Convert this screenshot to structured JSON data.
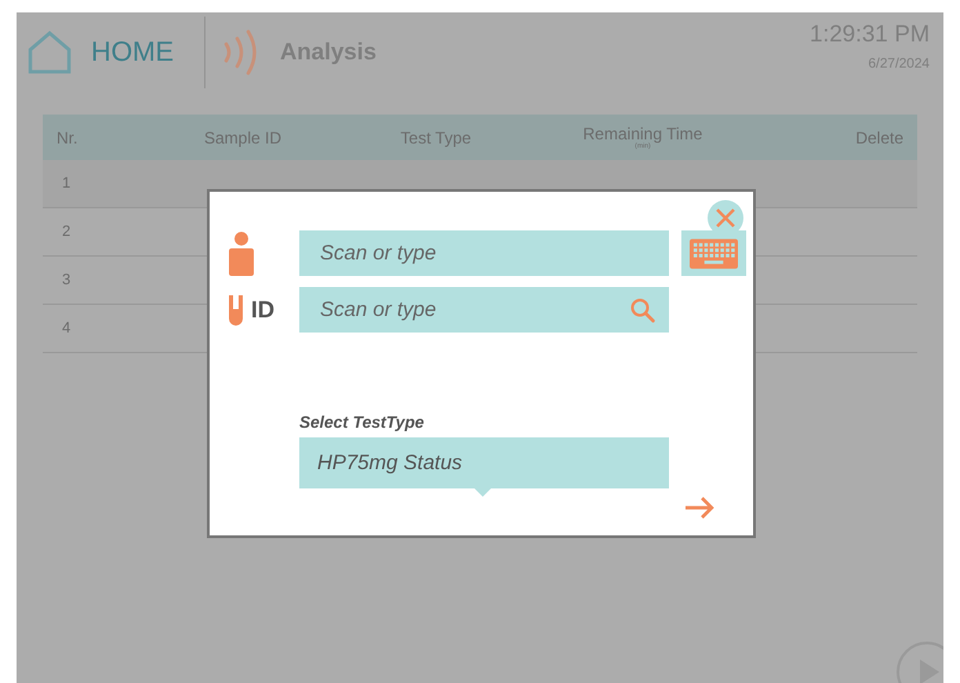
{
  "header": {
    "home_label": "HOME",
    "title": "Analysis",
    "time": "1:29:31 PM",
    "date": "6/27/2024"
  },
  "table": {
    "columns": [
      {
        "label": "Nr."
      },
      {
        "label": "Sample ID"
      },
      {
        "label": "Test Type"
      },
      {
        "label": "Remaining Time",
        "unit": "(min)"
      },
      {
        "label": "Delete"
      }
    ],
    "rows": [
      {
        "nr": "1"
      },
      {
        "nr": "2"
      },
      {
        "nr": "3"
      },
      {
        "nr": "4"
      }
    ]
  },
  "dialog": {
    "fields": [
      {
        "kind": "user",
        "placeholder": "Scan or type"
      },
      {
        "kind": "id",
        "label": "ID",
        "placeholder": "Scan or type"
      }
    ],
    "select_label": "Select TestType",
    "select_value": "HP75mg Status"
  }
}
